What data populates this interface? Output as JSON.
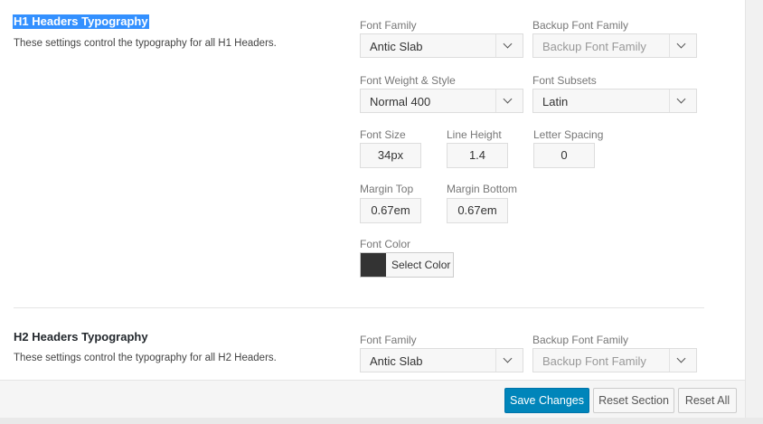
{
  "h1_section": {
    "title": "H1 Headers Typography",
    "description": "These settings control the typography for all H1 Headers.",
    "font_family_label": "Font Family",
    "font_family_value": "Antic Slab",
    "backup_font_label": "Backup Font Family",
    "backup_font_placeholder": "Backup Font Family",
    "font_weight_label": "Font Weight & Style",
    "font_weight_value": "Normal 400",
    "font_subsets_label": "Font Subsets",
    "font_subsets_value": "Latin",
    "font_size_label": "Font Size",
    "font_size_value": "34px",
    "line_height_label": "Line Height",
    "line_height_value": "1.4",
    "letter_spacing_label": "Letter Spacing",
    "letter_spacing_value": "0",
    "margin_top_label": "Margin Top",
    "margin_top_value": "0.67em",
    "margin_bottom_label": "Margin Bottom",
    "margin_bottom_value": "0.67em",
    "font_color_label": "Font Color",
    "font_color_button": "Select Color",
    "font_color_value": "#333333"
  },
  "h2_section": {
    "title": "H2 Headers Typography",
    "description": "These settings control the typography for all H2 Headers.",
    "font_family_label": "Font Family",
    "font_family_value": "Antic Slab",
    "backup_font_label": "Backup Font Family",
    "backup_font_placeholder": "Backup Font Family"
  },
  "footer": {
    "save_label": "Save Changes",
    "reset_section_label": "Reset Section",
    "reset_all_label": "Reset All"
  },
  "icons": {
    "dropdown": "chevron-down-icon"
  },
  "colors": {
    "primary": "#0085ba",
    "selection": "#3390ff"
  }
}
